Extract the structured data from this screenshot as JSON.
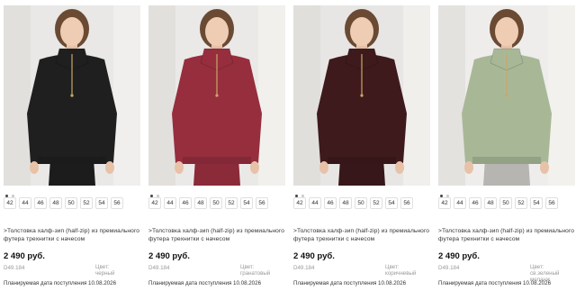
{
  "products": [
    {
      "title": ">Толстовка халф-зип (half-zip) из премиального футера трехнитки с начесом",
      "price": "2 490 руб.",
      "sku": "D49.184",
      "color_label": "Цвет:",
      "color_value": "черный",
      "arrival": "Планируемая дата поступления 10.08.2026",
      "sizes": [
        "42",
        "44",
        "46",
        "48",
        "50",
        "52",
        "54",
        "56"
      ],
      "sweater_color": "#1f1f1f",
      "pants_color": "#1c1c1c",
      "bg_color": "#e9e8e6"
    },
    {
      "title": ">Толстовка халф-зип (half-zip) из премиального футера трехнитки с начесом",
      "price": "2 490 руб.",
      "sku": "D49.184",
      "color_label": "Цвет:",
      "color_value": "гранатовый",
      "arrival": "Планируемая дата поступления 10.08.2026",
      "sizes": [
        "42",
        "44",
        "46",
        "48",
        "50",
        "52",
        "54",
        "56"
      ],
      "sweater_color": "#962e3e",
      "pants_color": "#8b2a38",
      "bg_color": "#ebe9e7"
    },
    {
      "title": ">Толстовка халф-зип (half-zip) из премиального футера трехнитки с начесом",
      "price": "2 490 руб.",
      "sku": "D49.184",
      "color_label": "Цвет:",
      "color_value": "коричневый",
      "arrival": "Планируемая дата поступления 10.08.2026",
      "sizes": [
        "42",
        "44",
        "46",
        "48",
        "50",
        "52",
        "54",
        "56"
      ],
      "sweater_color": "#3e1a1c",
      "pants_color": "#371719",
      "bg_color": "#e8e6e4"
    },
    {
      "title": ">Толстовка халф-зип (half-zip) из премиального футера трехнитки с начесом",
      "price": "2 490 руб.",
      "sku": "D49.184",
      "color_label": "Цвет:",
      "color_value": "св.зеленый меланж",
      "arrival": "Планируемая дата поступления 10.08.2026",
      "sizes": [
        "42",
        "44",
        "46",
        "48",
        "50",
        "52",
        "54",
        "56"
      ],
      "sweater_color": "#a8b897",
      "pants_color": "#b7b5b2",
      "bg_color": "#eeedeb"
    }
  ]
}
